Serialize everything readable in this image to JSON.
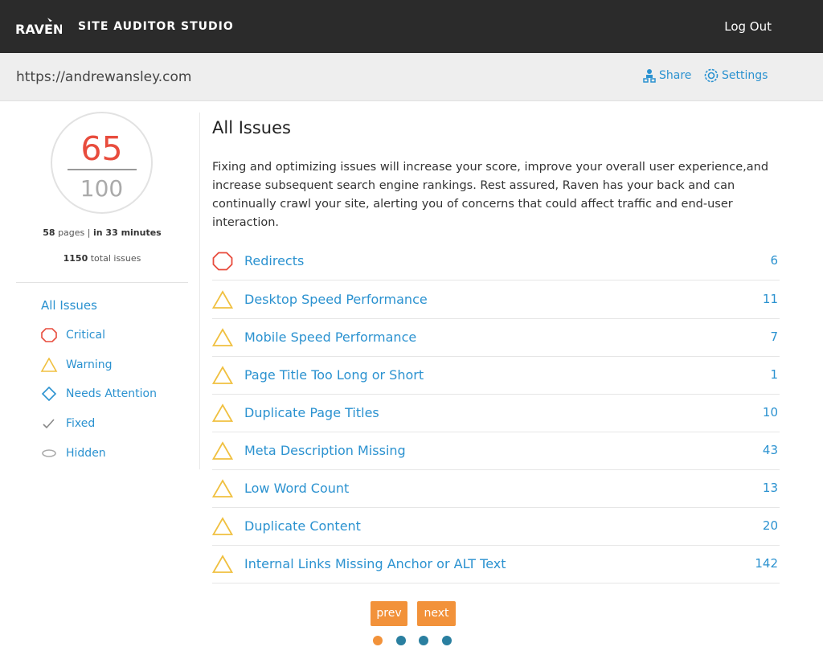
{
  "header": {
    "logo_text": "RAVEN",
    "app_title": "SITE AUDITOR STUDIO",
    "logout_label": "Log Out"
  },
  "urlbar": {
    "url": "https://andrewansley.com",
    "share_label": "Share",
    "settings_label": "Settings"
  },
  "score": {
    "value": "65",
    "max": "100",
    "pages": "58",
    "pages_suffix": "pages",
    "separator": "|",
    "duration": "in 33 minutes",
    "total": "1150",
    "total_suffix": "total issues"
  },
  "filters": {
    "all_label": "All Issues",
    "items": [
      {
        "label": "Critical",
        "icon": "octagon-icon"
      },
      {
        "label": "Warning",
        "icon": "triangle-icon"
      },
      {
        "label": "Needs Attention",
        "icon": "diamond-icon"
      },
      {
        "label": "Fixed",
        "icon": "check-icon"
      },
      {
        "label": "Hidden",
        "icon": "eye-icon"
      }
    ]
  },
  "main": {
    "title": "All Issues",
    "intro": "Fixing and optimizing issues will increase your score, improve your overall user experience,and increase subsequent search engine rankings. Rest assured, Raven has your back and can continually crawl your site, alerting you of concerns that could affect traffic and end-user interaction.",
    "issues": [
      {
        "name": "Redirects",
        "count": "6",
        "severity": "critical"
      },
      {
        "name": "Desktop Speed Performance",
        "count": "11",
        "severity": "warning"
      },
      {
        "name": "Mobile Speed Performance",
        "count": "7",
        "severity": "warning"
      },
      {
        "name": "Page Title Too Long or Short",
        "count": "1",
        "severity": "warning"
      },
      {
        "name": "Duplicate Page Titles",
        "count": "10",
        "severity": "warning"
      },
      {
        "name": "Meta Description Missing",
        "count": "43",
        "severity": "warning"
      },
      {
        "name": "Low Word Count",
        "count": "13",
        "severity": "warning"
      },
      {
        "name": "Duplicate Content",
        "count": "20",
        "severity": "warning"
      },
      {
        "name": "Internal Links Missing Anchor or ALT Text",
        "count": "142",
        "severity": "warning"
      }
    ]
  },
  "pagination": {
    "prev_label": "prev",
    "next_label": "next",
    "active_page": 1,
    "total_pages": 4
  },
  "colors": {
    "accent": "#2b92d0",
    "critical": "#e84c3d",
    "warning": "#f0c040",
    "button": "#f2923a",
    "dot_inactive": "#2a7fa0"
  }
}
